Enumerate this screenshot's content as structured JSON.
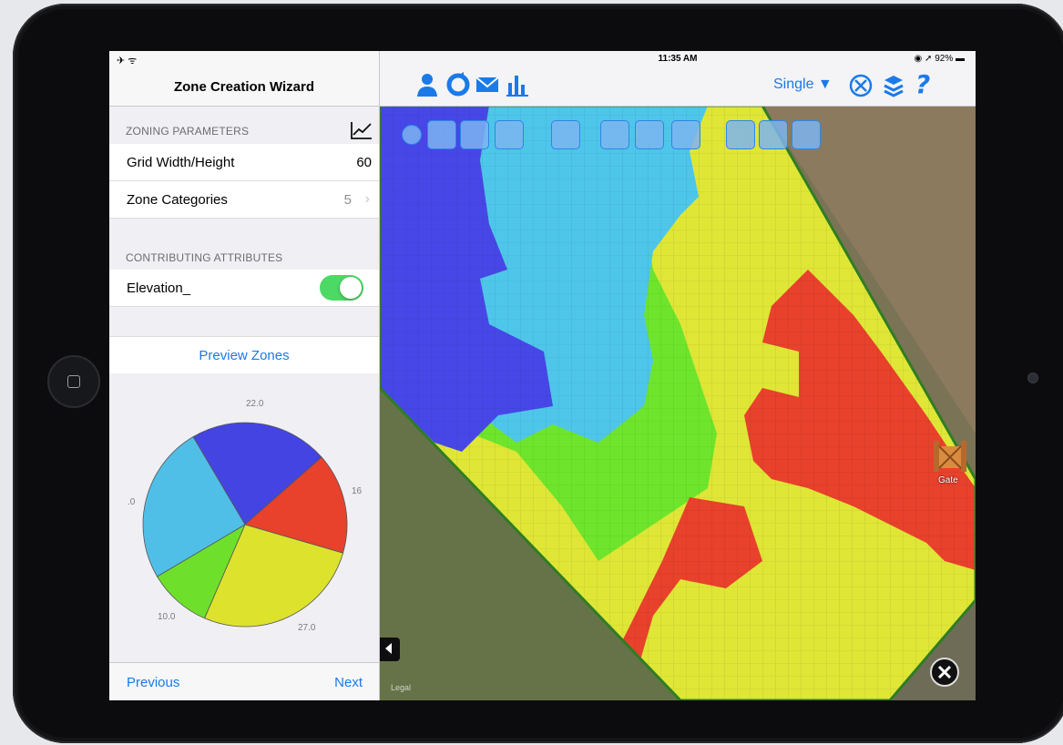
{
  "left_panel": {
    "nav_title": "Zone Creation Wizard",
    "zoning_header": "ZONING PARAMETERS",
    "grid_label": "Grid Width/Height",
    "grid_value": "60",
    "zone_categories_label": "Zone Categories",
    "zone_categories_value": "5",
    "contributing_header": "CONTRIBUTING ATTRIBUTES",
    "elevation_label": "Elevation_",
    "elevation_enabled": true,
    "preview_label": "Preview Zones",
    "previous_label": "Previous",
    "next_label": "Next",
    "pie_labels": {
      "top": "22.0",
      "right": "16",
      "left": ".0",
      "bottom_left": "10.0",
      "bottom_right": "27.0"
    },
    "pie_slices": [
      {
        "value": 22,
        "color": "#4444e2"
      },
      {
        "value": 16,
        "color": "#e8412c"
      },
      {
        "value": 27,
        "color": "#dde32c"
      },
      {
        "value": 10,
        "color": "#6ee02c"
      },
      {
        "value": 25,
        "color": "#50bfe8"
      }
    ]
  },
  "map_panel": {
    "time": "11:35 AM",
    "battery": "92%",
    "mode_label": "Single ▼",
    "help_label": "?",
    "gate_label": "Gate",
    "legal_label": "Legal",
    "zone_colors": {
      "blue": "#4747e8",
      "cyan": "#4ec6ea",
      "green": "#6ee52c",
      "yellow": "#dfe636",
      "red": "#e8412c"
    },
    "accent": "#1a7ae8"
  }
}
